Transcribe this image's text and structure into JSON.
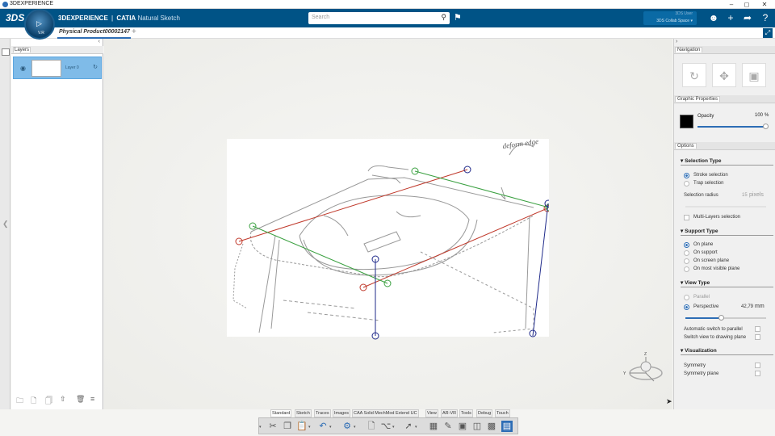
{
  "window": {
    "title": "3DEXPERIENCE",
    "controls": [
      "–",
      "◻",
      "✕"
    ]
  },
  "topbar": {
    "brand_bold": "3DEXPERIENCE",
    "brand_sep": "|",
    "brand_catia": "CATIA",
    "brand_app": "Natural Sketch",
    "compass_version": "V.R",
    "search_placeholder": "Search",
    "collab_line1": "3DS User",
    "collab_line2": "3DS Collab Space ▾",
    "icons": [
      "user-icon",
      "plus-icon",
      "share-icon",
      "help-icon"
    ]
  },
  "tabrow": {
    "doc_title": "Physical Product00002147",
    "add_label": "+"
  },
  "layers": {
    "header": "Layers",
    "collapse": "‹",
    "rows": [
      {
        "name": "Layer 0"
      }
    ]
  },
  "navigation": {
    "header": "Navigation"
  },
  "graphic_properties": {
    "header": "Graphic Properties",
    "swatch_color": "#000000",
    "opacity_label": "Opacity",
    "opacity_value": "100",
    "opacity_unit": "%",
    "opacity_fraction": 1.0
  },
  "options": {
    "header": "Options",
    "selection_type": {
      "title": "Selection Type",
      "items": [
        {
          "label": "Stroke selection",
          "selected": true
        },
        {
          "label": "Trap selection",
          "selected": false
        }
      ],
      "radius_label": "Selection radius",
      "radius_value": "15",
      "radius_unit": "pixels",
      "multilayer_label": "Multi-Layers selection"
    },
    "support_type": {
      "title": "Support Type",
      "items": [
        {
          "label": "On plane",
          "selected": true
        },
        {
          "label": "On support",
          "selected": false
        },
        {
          "label": "On screen plane",
          "selected": false
        },
        {
          "label": "On most visible plane",
          "selected": false
        }
      ]
    },
    "view_type": {
      "title": "View Type",
      "items": [
        {
          "label": "Parallel",
          "selected": false
        },
        {
          "label": "Perspective",
          "selected": true
        }
      ],
      "angle_value": "42,79",
      "angle_unit": "mm",
      "angle_fraction": 0.45,
      "auto_switch_label": "Automatic switch to parallel",
      "switch_view_label": "Switch view to drawing plane"
    },
    "visualization": {
      "title": "Visualization",
      "symmetry_label": "Symmetry",
      "symmetry_plane_label": "Symmetry plane"
    }
  },
  "bottom_tabs": [
    "Standard",
    "Sketch",
    "Traces",
    "Images",
    "CAA Solid MechMod Extend UC",
    "View",
    "AR-VR",
    "Tools",
    "Debug",
    "Touch"
  ],
  "active_bottom_tab": "Standard",
  "compass3d": {
    "z": "Z",
    "y": "Y"
  },
  "sketch_note": "deform edge",
  "colors": {
    "brand_blue": "#005386",
    "accent": "#2d6db5",
    "red_line": "#c0392b",
    "green_line": "#3aa040",
    "blue_line": "#1f2a8a"
  }
}
